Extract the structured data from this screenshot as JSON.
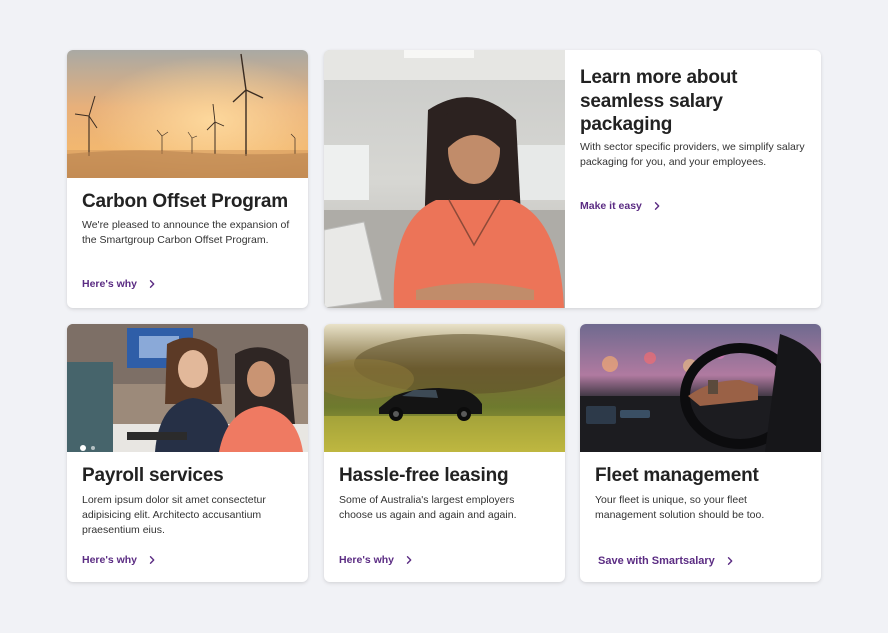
{
  "cards": {
    "carbon": {
      "title": "Carbon Offset Program",
      "description": "We're pleased to announce the expansion of the Smartgroup Carbon Offset Program.",
      "link_label": "Here's why"
    },
    "salary": {
      "title": "Learn more about seamless salary packaging",
      "description": "With sector specific providers, we simplify salary packaging for you, and your employees.",
      "link_label": "Make it easy"
    },
    "payroll": {
      "title": "Payroll services",
      "description": "Lorem ipsum dolor sit amet consectetur adipisicing elit. Architecto accusantium praesentium eius.",
      "link_label": "Here's why"
    },
    "leasing": {
      "title": "Hassle-free leasing",
      "description": "Some of Australia's largest employers choose us again and again and again.",
      "link_label": "Here's why"
    },
    "fleet": {
      "title": "Fleet management",
      "description": "Your fleet is unique, so your fleet management solution should be too.",
      "link_label": "Save with Smartsalary"
    }
  },
  "icons": {
    "link_arrow": "chevron-right-icon"
  },
  "colors": {
    "page_background": "#f1f2f6",
    "link": "#5b2c83",
    "heading": "#222222"
  }
}
